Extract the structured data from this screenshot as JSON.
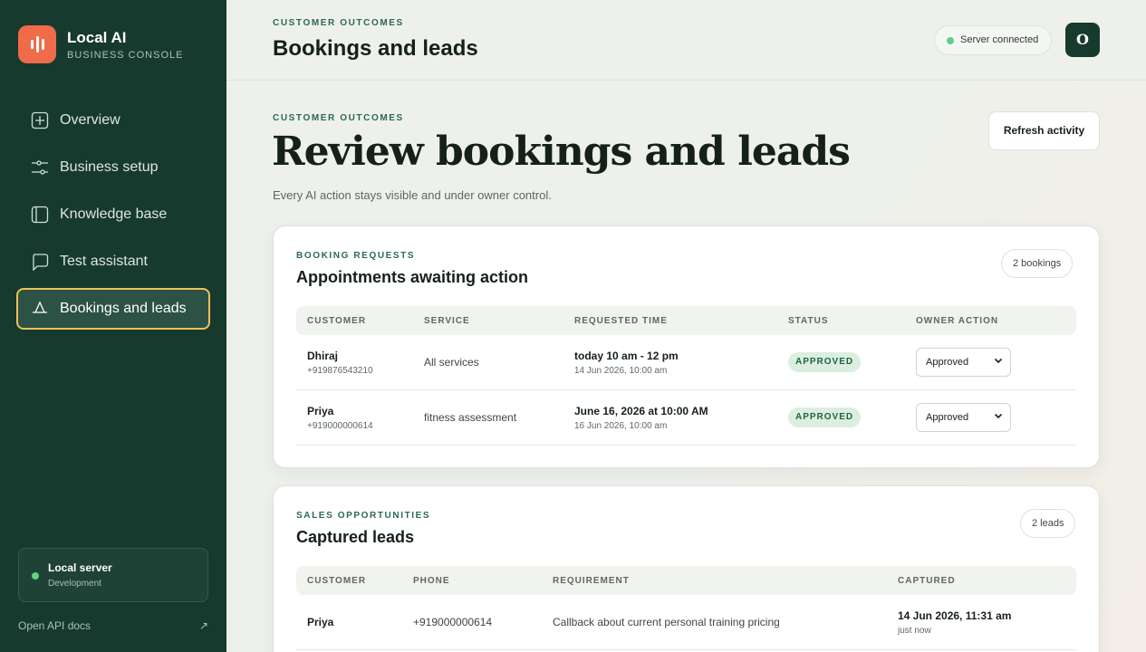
{
  "brand": {
    "name": "Local AI",
    "subtitle": "BUSINESS CONSOLE"
  },
  "sidebar": {
    "items": [
      {
        "label": "Overview",
        "icon": "plus-square-icon",
        "active": false
      },
      {
        "label": "Business setup",
        "icon": "sliders-icon",
        "active": false
      },
      {
        "label": "Knowledge base",
        "icon": "book-icon",
        "active": false
      },
      {
        "label": "Test assistant",
        "icon": "chat-icon",
        "active": false
      },
      {
        "label": "Bookings and leads",
        "icon": "inbox-icon",
        "active": true
      }
    ],
    "server": {
      "title": "Local server",
      "subtitle": "Development"
    },
    "api_link": {
      "label": "Open API docs",
      "icon": "↗"
    }
  },
  "topbar": {
    "eyebrow": "CUSTOMER OUTCOMES",
    "title": "Bookings and leads",
    "status": "Server connected",
    "avatar": "O"
  },
  "hero": {
    "eyebrow": "CUSTOMER OUTCOMES",
    "title": "Review bookings and leads",
    "subtitle": "Every AI action stays visible and under owner control.",
    "refresh_label": "Refresh activity"
  },
  "bookings": {
    "eyebrow": "BOOKING REQUESTS",
    "title": "Appointments awaiting action",
    "count": "2 bookings",
    "columns": [
      "CUSTOMER",
      "SERVICE",
      "REQUESTED TIME",
      "STATUS",
      "OWNER ACTION"
    ],
    "rows": [
      {
        "name": "Dhiraj",
        "phone": "+919876543210",
        "service": "All services",
        "time": "today 10 am - 12 pm",
        "time_sub": "14 Jun 2026, 10:00 am",
        "status": "APPROVED",
        "action": "Approved"
      },
      {
        "name": "Priya",
        "phone": "+919000000614",
        "service": "fitness assessment",
        "time": "June 16, 2026 at 10:00 AM",
        "time_sub": "16 Jun 2026, 10:00 am",
        "status": "APPROVED",
        "action": "Approved"
      }
    ]
  },
  "leads": {
    "eyebrow": "SALES OPPORTUNITIES",
    "title": "Captured leads",
    "count": "2 leads",
    "columns": [
      "CUSTOMER",
      "PHONE",
      "REQUIREMENT",
      "CAPTURED"
    ],
    "rows": [
      {
        "name": "Priya",
        "phone": "+919000000614",
        "requirement": "Callback about current personal training pricing",
        "captured": "14 Jun 2026, 11:31 am",
        "captured_sub": "just now"
      }
    ]
  },
  "colors": {
    "sidebar": "#173a2e",
    "accent": "#ef6b4a",
    "active_border": "#f0c05a",
    "status_green": "#5ed089"
  }
}
